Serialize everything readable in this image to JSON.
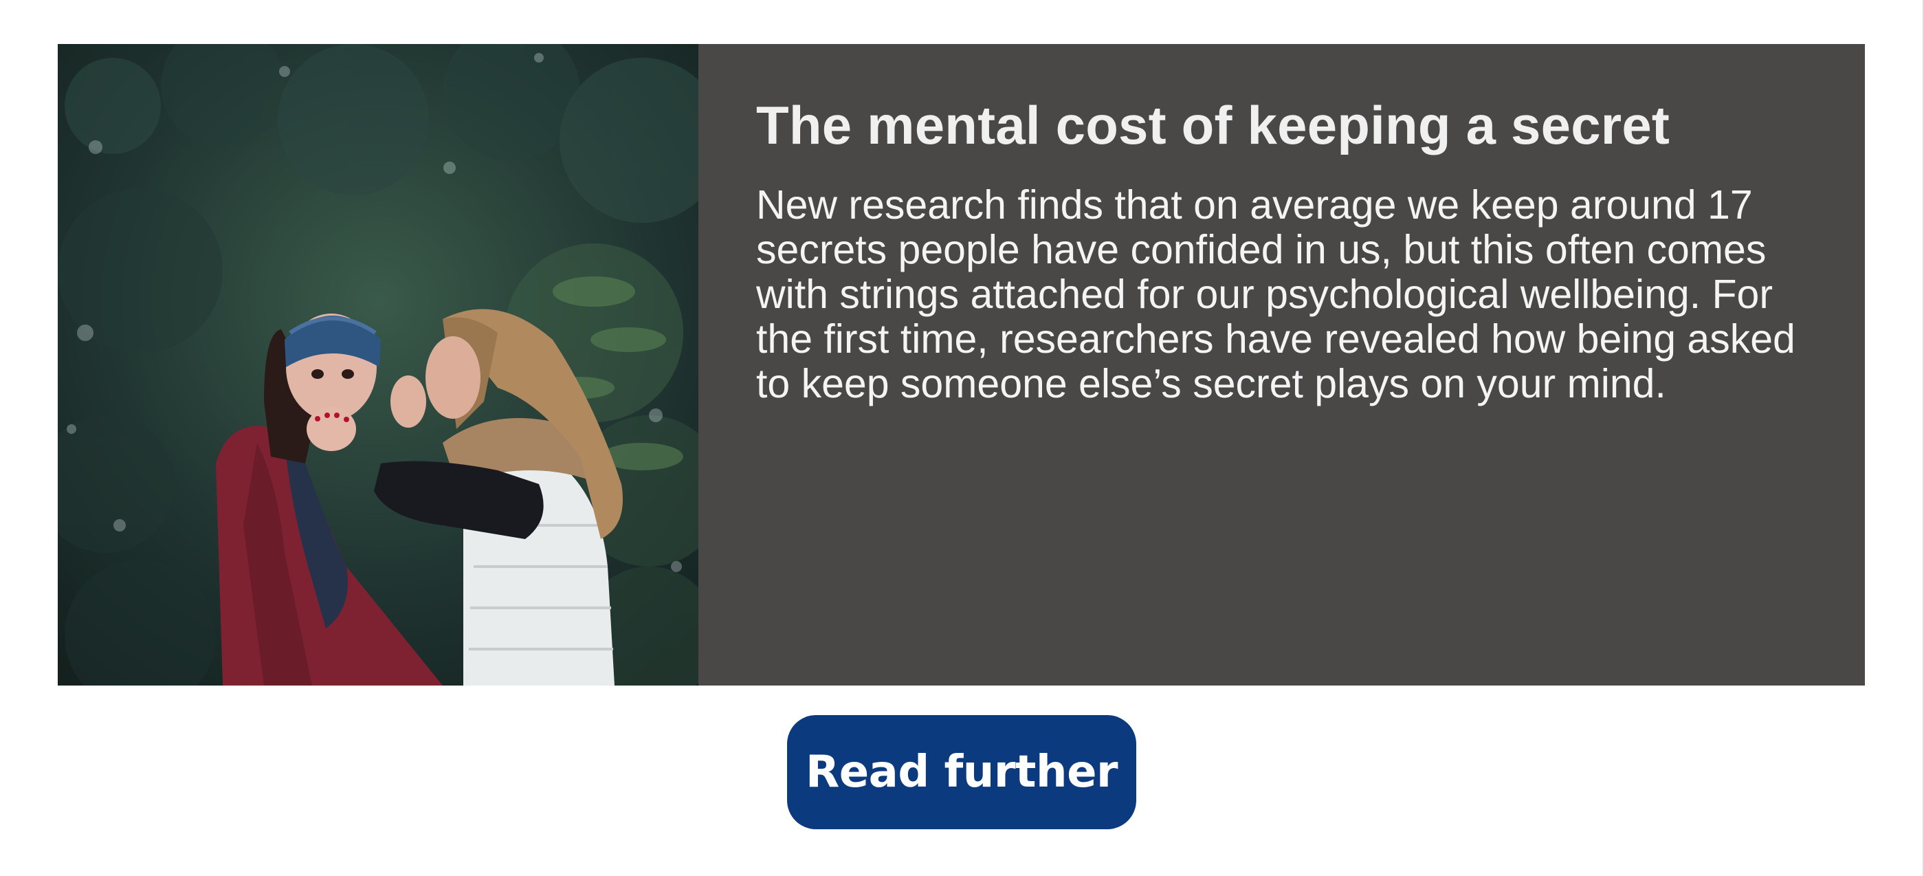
{
  "article": {
    "title": "The mental cost of keeping a secret",
    "body": "New research finds that on average we keep around 17 secrets people have confided in us, but this often comes with strings attached for our psychological wellbeing. For the first time, researchers have revealed how being asked to keep someone else’s secret plays on your mind.",
    "image_icon": "photo-two-people-whispering",
    "panel_color": "#4a4847"
  },
  "cta": {
    "label": "Read further",
    "color": "#0b3b7e"
  }
}
